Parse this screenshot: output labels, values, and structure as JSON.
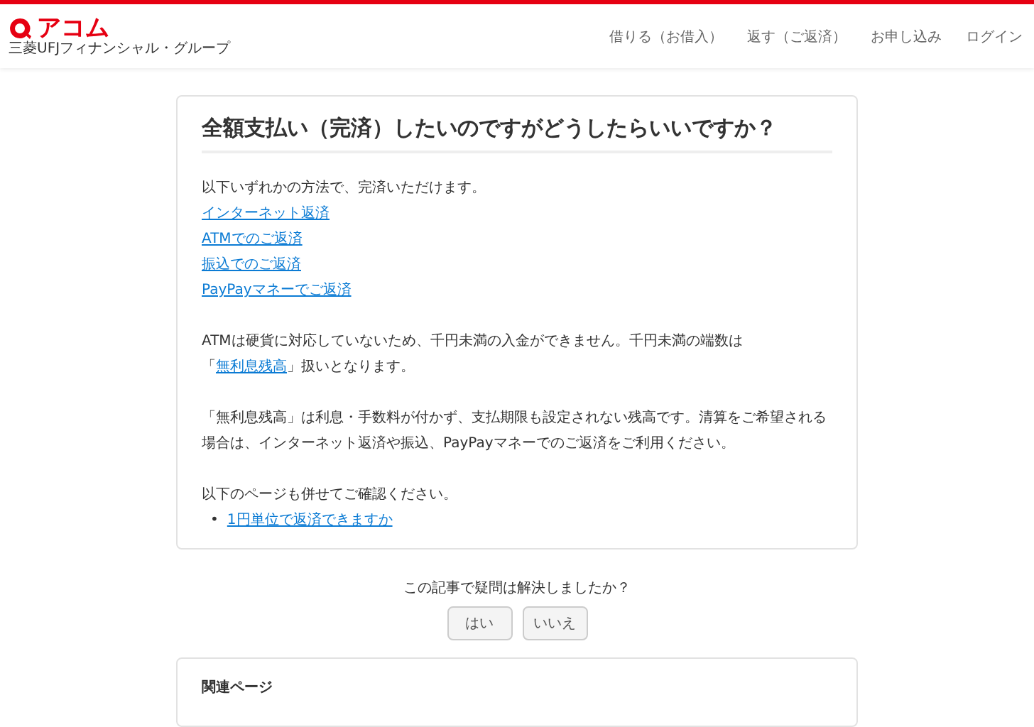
{
  "header": {
    "logo": {
      "name": "アコム",
      "group": "三菱UFJフィナンシャル・グループ"
    },
    "nav": [
      "借りる（お借入）",
      "返す（ご返済）",
      "お申し込み",
      "ログイン"
    ]
  },
  "article": {
    "title": "全額支払い（完済）したいのですがどうしたらいいですか？",
    "blocks": [
      {
        "kind": "text",
        "text": "以下いずれかの方法で、完済いただけます。"
      },
      {
        "kind": "link",
        "text": "インターネット返済"
      },
      {
        "kind": "link",
        "text": "ATMでのご返済"
      },
      {
        "kind": "link",
        "text": "振込でのご返済"
      },
      {
        "kind": "link",
        "text": "PayPayマネーでご返済"
      },
      {
        "kind": "paragraph",
        "parts": [
          {
            "kind": "text",
            "text": "ATMは硬貨に対応していないため、千円未満の入金ができません。千円未満の端数は「"
          },
          {
            "kind": "link",
            "text": "無利息残高"
          },
          {
            "kind": "text",
            "text": "」扱いとなります。"
          }
        ]
      },
      {
        "kind": "paragraph",
        "parts": [
          {
            "kind": "text",
            "text": "「無利息残高」は利息・手数料が付かず、支払期限も設定されない残高です。清算をご希望される場合は、インターネット返済や振込、PayPayマネーでのご返済をご利用ください。"
          }
        ]
      },
      {
        "kind": "paragraph",
        "parts": [
          {
            "kind": "text",
            "text": "以下のページも併せてご確認ください。"
          }
        ]
      },
      {
        "kind": "bullet",
        "marker": "•",
        "text": "1円単位で返済できますか"
      }
    ]
  },
  "feedback": {
    "question": "この記事で疑問は解決しましたか？",
    "buttons": [
      "はい",
      "いいえ"
    ]
  },
  "related": {
    "title": "関連ページ"
  }
}
